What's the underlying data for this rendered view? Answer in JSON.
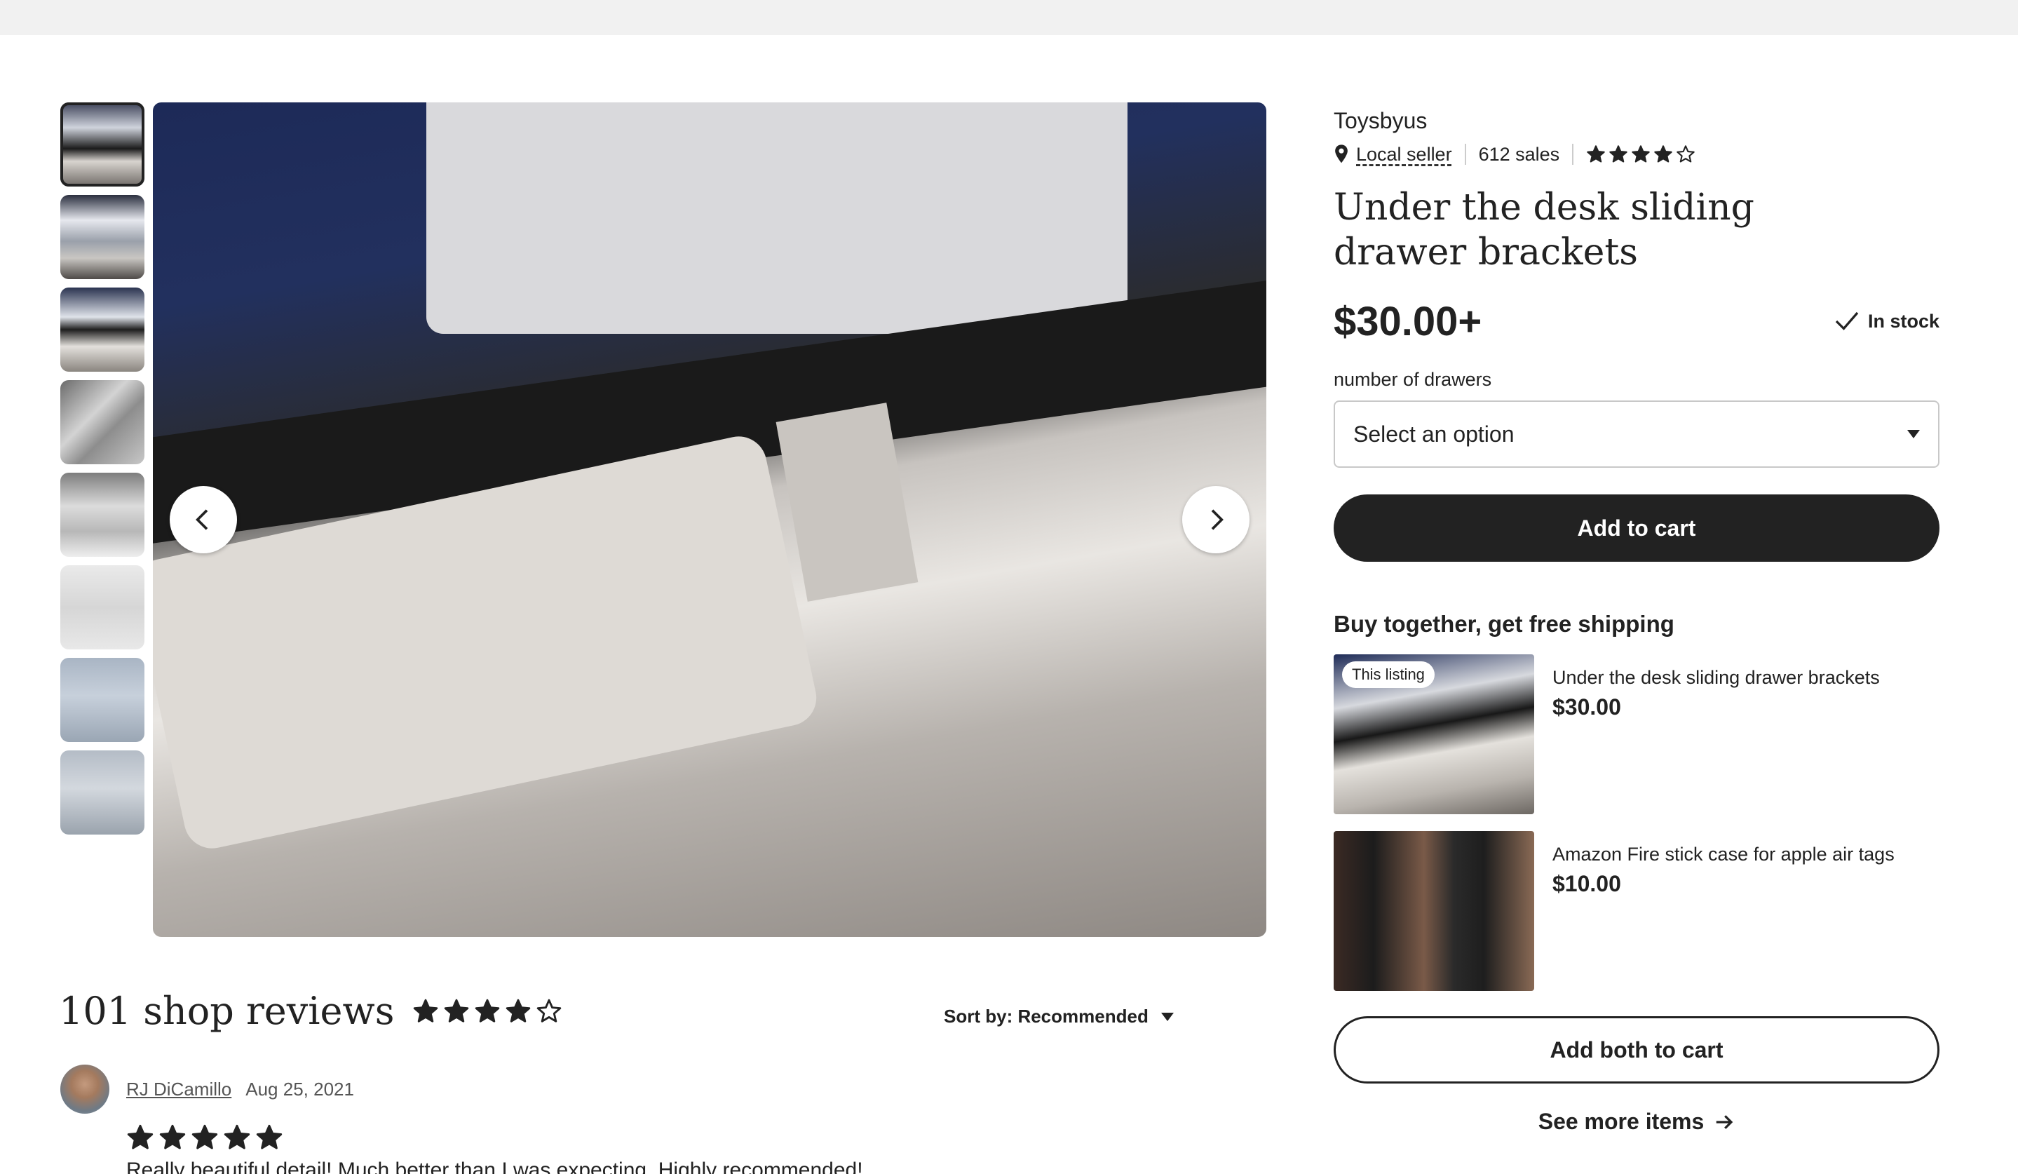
{
  "shop": {
    "name": "Toysbyus",
    "local_label": "Local seller",
    "sales": "612 sales",
    "rating": 4
  },
  "listing": {
    "title": "Under the desk sliding drawer brackets",
    "price": "$30.00+",
    "stock": "In stock",
    "option_label": "number of drawers",
    "select_placeholder": "Select an option",
    "add_to_cart": "Add to cart"
  },
  "bundle": {
    "title": "Buy together, get free shipping",
    "items": [
      {
        "badge": "This listing",
        "name": "Under the desk sliding drawer brackets",
        "price": "$30.00"
      },
      {
        "name": "Amazon Fire stick case for apple air tags",
        "price": "$10.00"
      }
    ],
    "add_both": "Add both to cart",
    "see_more": "See more items"
  },
  "gallery": {
    "thumbnail_count": 8,
    "active_index": 0
  },
  "reviews": {
    "title": "101 shop reviews",
    "rating": 4,
    "sort_label": "Sort by: Recommended",
    "items": [
      {
        "reviewer": "RJ DiCamillo",
        "date": "Aug 25, 2021",
        "rating": 5,
        "text": "Really beautiful detail! Much better than I was expecting. Highly recommended!"
      }
    ]
  },
  "icons": {
    "location": "map-pin-icon",
    "check": "check-icon",
    "prev": "chevron-left-icon",
    "next": "chevron-right-icon",
    "arrow": "arrow-right-icon",
    "star": "star-icon"
  }
}
